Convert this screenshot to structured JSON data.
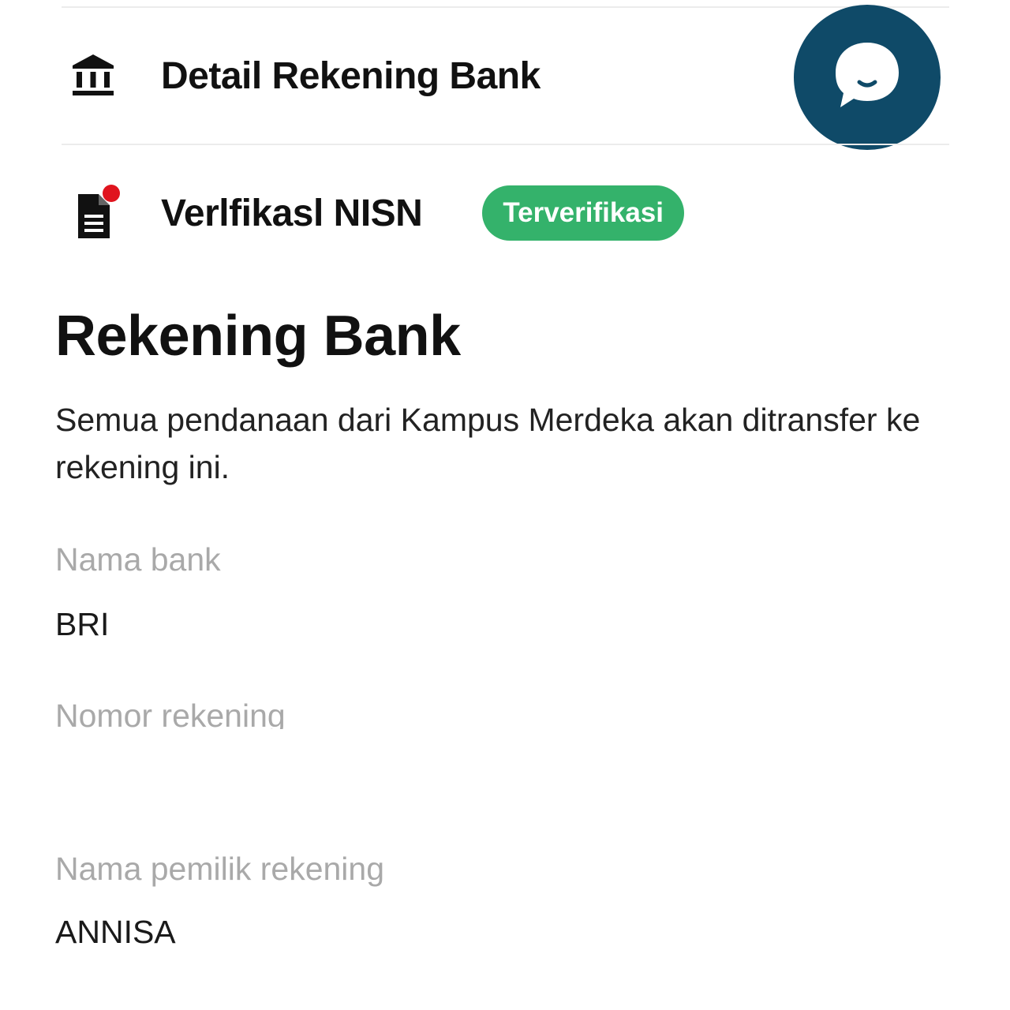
{
  "menu": {
    "bank_detail": {
      "label": "Detail Rekening Bank",
      "icon": "bank-icon"
    },
    "nisn": {
      "label": "Verlfikasl NISN",
      "icon": "document-icon",
      "badge": "Terverifikasi",
      "badge_color": "#34b26b",
      "notification_dot_color": "#e0141e"
    }
  },
  "chat": {
    "icon": "chat-bubble-icon",
    "color": "#0f4a68"
  },
  "section": {
    "title": "Rekening Bank",
    "description": "Semua pendanaan dari Kampus Merdeka akan ditransfer ke rekening ini."
  },
  "fields": {
    "bank_name_label": "Nama bank",
    "bank_name_value": "BRI",
    "account_number_label": "Nomor rekening",
    "account_number_value": "",
    "owner_label": "Nama pemilik rekening",
    "owner_value": "ANNISA"
  }
}
